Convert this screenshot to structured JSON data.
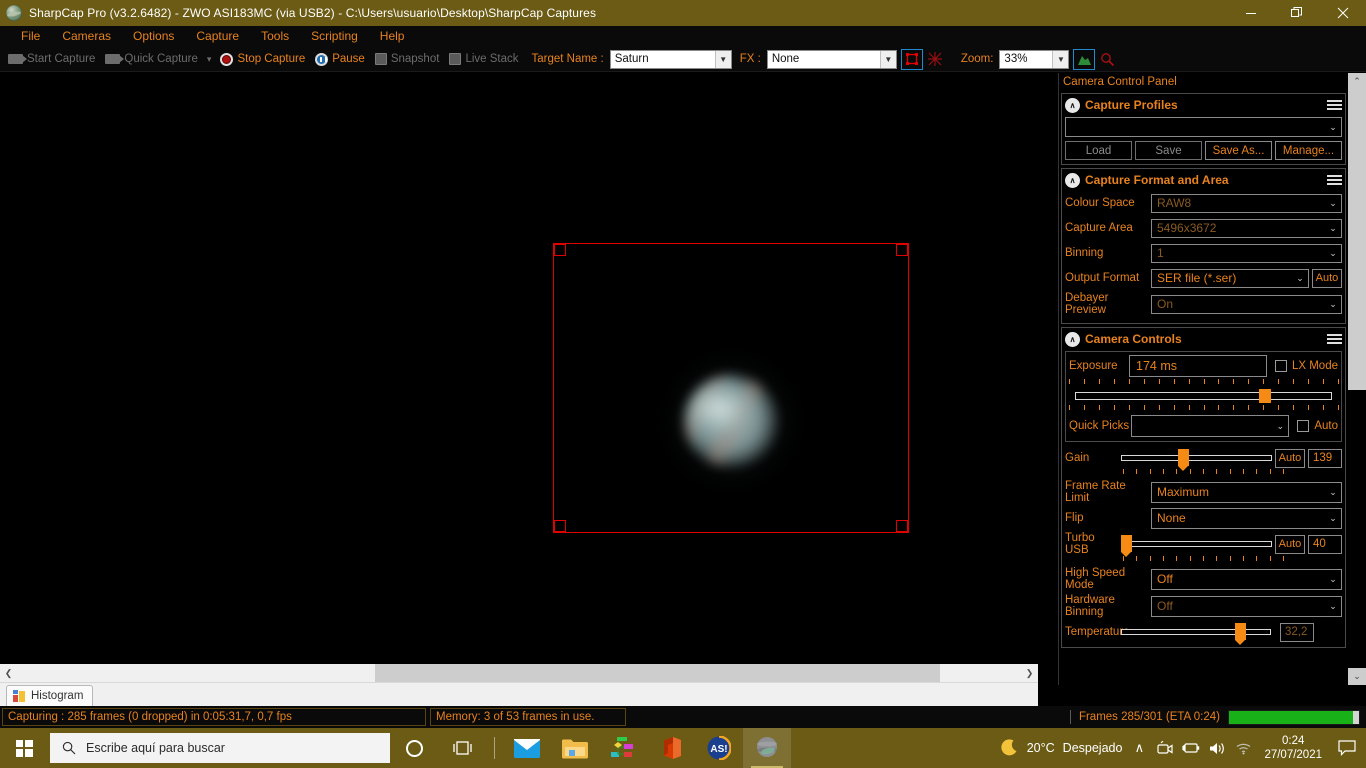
{
  "titlebar": {
    "title": "SharpCap Pro (v3.2.6482) - ZWO ASI183MC (via USB2) - C:\\Users\\usuario\\Desktop\\SharpCap Captures",
    "minimize": "—",
    "restore": "❐",
    "close": "✕"
  },
  "menu": {
    "items": [
      {
        "label": "File"
      },
      {
        "label": "Cameras"
      },
      {
        "label": "Options"
      },
      {
        "label": "Capture"
      },
      {
        "label": "Tools"
      },
      {
        "label": "Scripting"
      },
      {
        "label": "Help"
      }
    ]
  },
  "toolbar": {
    "start_capture": "Start Capture",
    "quick_capture": "Quick Capture",
    "dropdown_caret": "▾",
    "stop_capture": "Stop Capture",
    "pause": "Pause",
    "snapshot": "Snapshot",
    "live_stack": "Live Stack",
    "target_name_label": "Target Name :",
    "target_name_value": "Saturn",
    "fx_label": "FX :",
    "fx_value": "None",
    "zoom_label": "Zoom:",
    "zoom_value": "33%",
    "caret": "⌄"
  },
  "panel": {
    "title": "Camera Control Panel",
    "pin_icon": "·",
    "collapse_icon": "∧",
    "groups": [
      {
        "name": "capture-profiles",
        "title": "Capture Profiles",
        "profile_value": "",
        "buttons": [
          {
            "label": "Load",
            "enabled": false
          },
          {
            "label": "Save",
            "enabled": false
          },
          {
            "label": "Save As...",
            "enabled": true
          },
          {
            "label": "Manage...",
            "enabled": true
          }
        ]
      },
      {
        "name": "capture-format-and-area",
        "title": "Capture Format and Area",
        "rows": [
          {
            "label": "Colour Space",
            "value": "RAW8",
            "dim": true
          },
          {
            "label": "Capture Area",
            "value": "5496x3672",
            "dim": true
          },
          {
            "label": "Binning",
            "value": "1",
            "dim": true
          },
          {
            "label": "Output Format",
            "value": "SER file (*.ser)",
            "dim": false,
            "auto": "Auto"
          },
          {
            "label": "Debayer Preview",
            "value": "On",
            "dim": true
          }
        ]
      },
      {
        "name": "camera-controls",
        "title": "Camera Controls",
        "exposure_label": "Exposure",
        "exposure_value": "174 ms",
        "lx_mode_label": "LX Mode",
        "quick_picks_label": "Quick Picks",
        "quick_picks_value": "",
        "quick_picks_auto": "Auto",
        "rows": [
          {
            "label": "Gain",
            "type": "slider",
            "auto": "Auto",
            "value": "139",
            "pos": 40
          },
          {
            "label": "Frame Rate Limit",
            "type": "combo",
            "value": "Maximum",
            "dim": false
          },
          {
            "label": "Flip",
            "type": "combo",
            "value": "None",
            "dim": false
          },
          {
            "label": "Turbo USB",
            "type": "slider",
            "auto": "Auto",
            "value": "40",
            "pos": 1
          },
          {
            "label": "High Speed Mode",
            "type": "combo",
            "value": "Off",
            "dim": false
          },
          {
            "label": "Hardware Binning",
            "type": "combo",
            "value": "Off",
            "dim": true
          },
          {
            "label": "Temperature",
            "type": "slider-ro",
            "value": "32,2",
            "pos": 77
          }
        ]
      }
    ]
  },
  "tabs": {
    "histogram": "Histogram"
  },
  "statusbar": {
    "capturing": "Capturing : 285 frames (0 dropped) in 0:05:31,7, 0,7 fps",
    "memory": "Memory: 3 of 53 frames in use.",
    "frames": "Frames 285/301 (ETA 0:24)",
    "progress_percent": 95
  },
  "taskbar": {
    "search_placeholder": "Escribe aquí para buscar",
    "weather_temp": "20°C",
    "weather_desc": "Despejado",
    "time": "0:24",
    "date": "27/07/2021",
    "chevron_up": "∧",
    "apps": [
      {
        "name": "mail-app-icon"
      },
      {
        "name": "file-explorer-icon"
      },
      {
        "name": "diagram-app-icon"
      },
      {
        "name": "office-app-icon"
      },
      {
        "name": "autostakkert-app-icon"
      },
      {
        "name": "sharpcap-app-icon"
      }
    ]
  },
  "colors": {
    "accent": "#e8821e",
    "titlebar": "#6b5b14",
    "roi": "#e00000",
    "progress": "#18b118",
    "slider": "#f58a14"
  }
}
